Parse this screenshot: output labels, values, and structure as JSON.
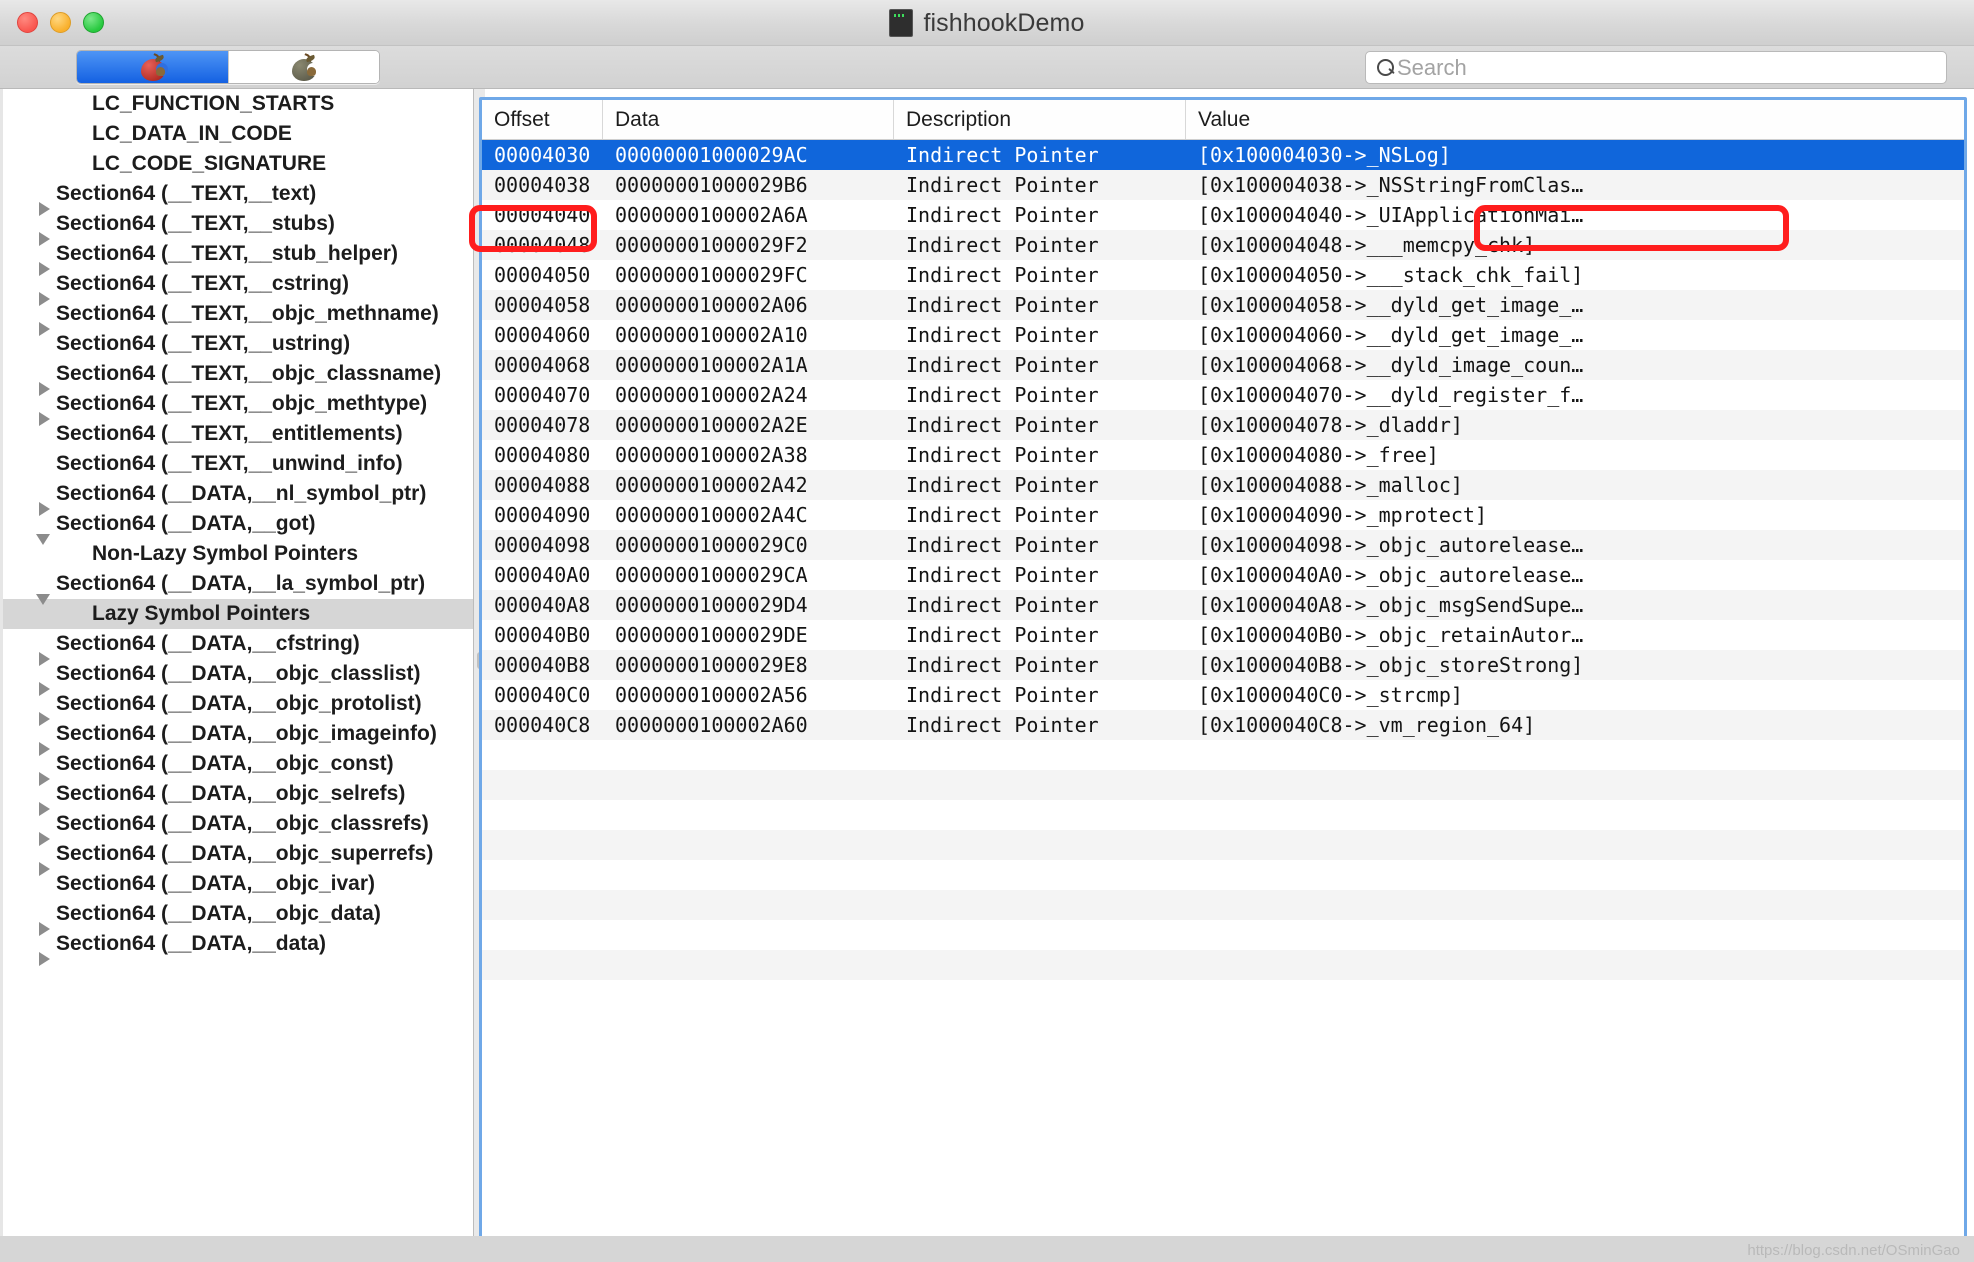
{
  "window": {
    "title": "fishhookDemo",
    "controls": {
      "close": "close-button",
      "minimize": "minimize-button",
      "zoom": "zoom-button"
    },
    "doc_icon": "terminal-document-icon"
  },
  "toolbar": {
    "segments": [
      {
        "name": "red-apple-segment",
        "icon": "red-apple-icon",
        "active": true
      },
      {
        "name": "grey-apple-segment",
        "icon": "grey-apple-icon",
        "active": false
      }
    ],
    "search": {
      "placeholder": "Search",
      "value": "",
      "icon": "search-icon"
    }
  },
  "sidebar": {
    "items": [
      {
        "label": "LC_FUNCTION_STARTS",
        "indent": 1,
        "twisty": "none",
        "selected": false
      },
      {
        "label": "LC_DATA_IN_CODE",
        "indent": 1,
        "twisty": "none",
        "selected": false
      },
      {
        "label": "LC_CODE_SIGNATURE",
        "indent": 1,
        "twisty": "none",
        "selected": false
      },
      {
        "label": "Section64 (__TEXT,__text)",
        "indent": 0,
        "twisty": "closed",
        "selected": false
      },
      {
        "label": "Section64 (__TEXT,__stubs)",
        "indent": 0,
        "twisty": "closed",
        "selected": false
      },
      {
        "label": "Section64 (__TEXT,__stub_helper)",
        "indent": 0,
        "twisty": "closed",
        "selected": false
      },
      {
        "label": "Section64 (__TEXT,__cstring)",
        "indent": 0,
        "twisty": "closed",
        "selected": false
      },
      {
        "label": "Section64 (__TEXT,__objc_methname)",
        "indent": 0,
        "twisty": "closed",
        "selected": false
      },
      {
        "label": "Section64 (__TEXT,__ustring)",
        "indent": 0,
        "twisty": "none",
        "selected": false
      },
      {
        "label": "Section64 (__TEXT,__objc_classname)",
        "indent": 0,
        "twisty": "closed",
        "selected": false
      },
      {
        "label": "Section64 (__TEXT,__objc_methtype)",
        "indent": 0,
        "twisty": "closed",
        "selected": false
      },
      {
        "label": "Section64 (__TEXT,__entitlements)",
        "indent": 0,
        "twisty": "none",
        "selected": false
      },
      {
        "label": "Section64 (__TEXT,__unwind_info)",
        "indent": 0,
        "twisty": "none",
        "selected": false
      },
      {
        "label": "Section64 (__DATA,__nl_symbol_ptr)",
        "indent": 0,
        "twisty": "closed",
        "selected": false
      },
      {
        "label": "Section64 (__DATA,__got)",
        "indent": 0,
        "twisty": "open",
        "selected": false
      },
      {
        "label": "Non-Lazy Symbol Pointers",
        "indent": 1,
        "twisty": "none",
        "selected": false
      },
      {
        "label": "Section64 (__DATA,__la_symbol_ptr)",
        "indent": 0,
        "twisty": "open",
        "selected": false
      },
      {
        "label": "Lazy Symbol Pointers",
        "indent": 1,
        "twisty": "none",
        "selected": true
      },
      {
        "label": "Section64 (__DATA,__cfstring)",
        "indent": 0,
        "twisty": "closed",
        "selected": false
      },
      {
        "label": "Section64 (__DATA,__objc_classlist)",
        "indent": 0,
        "twisty": "closed",
        "selected": false
      },
      {
        "label": "Section64 (__DATA,__objc_protolist)",
        "indent": 0,
        "twisty": "closed",
        "selected": false
      },
      {
        "label": "Section64 (__DATA,__objc_imageinfo)",
        "indent": 0,
        "twisty": "closed",
        "selected": false
      },
      {
        "label": "Section64 (__DATA,__objc_const)",
        "indent": 0,
        "twisty": "closed",
        "selected": false
      },
      {
        "label": "Section64 (__DATA,__objc_selrefs)",
        "indent": 0,
        "twisty": "closed",
        "selected": false
      },
      {
        "label": "Section64 (__DATA,__objc_classrefs)",
        "indent": 0,
        "twisty": "closed",
        "selected": false
      },
      {
        "label": "Section64 (__DATA,__objc_superrefs)",
        "indent": 0,
        "twisty": "closed",
        "selected": false
      },
      {
        "label": "Section64 (__DATA,__objc_ivar)",
        "indent": 0,
        "twisty": "none",
        "selected": false
      },
      {
        "label": "Section64 (__DATA,__objc_data)",
        "indent": 0,
        "twisty": "closed",
        "selected": false
      },
      {
        "label": "Section64 (__DATA,__data)",
        "indent": 0,
        "twisty": "closed",
        "selected": false
      }
    ]
  },
  "table": {
    "columns": [
      "Offset",
      "Data",
      "Description",
      "Value"
    ],
    "rows": [
      {
        "offset": "00004030",
        "data": "00000001000029AC",
        "description": "Indirect Pointer",
        "value": "[0x100004030->_NSLog]",
        "selected": true
      },
      {
        "offset": "00004038",
        "data": "00000001000029B6",
        "description": "Indirect Pointer",
        "value": "[0x100004038->_NSStringFromClas…",
        "selected": false
      },
      {
        "offset": "00004040",
        "data": "0000000100002A6A",
        "description": "Indirect Pointer",
        "value": "[0x100004040->_UIApplicationMai…",
        "selected": false
      },
      {
        "offset": "00004048",
        "data": "00000001000029F2",
        "description": "Indirect Pointer",
        "value": "[0x100004048->___memcpy_chk]",
        "selected": false
      },
      {
        "offset": "00004050",
        "data": "00000001000029FC",
        "description": "Indirect Pointer",
        "value": "[0x100004050->___stack_chk_fail]",
        "selected": false
      },
      {
        "offset": "00004058",
        "data": "0000000100002A06",
        "description": "Indirect Pointer",
        "value": "[0x100004058->__dyld_get_image_…",
        "selected": false
      },
      {
        "offset": "00004060",
        "data": "0000000100002A10",
        "description": "Indirect Pointer",
        "value": "[0x100004060->__dyld_get_image_…",
        "selected": false
      },
      {
        "offset": "00004068",
        "data": "0000000100002A1A",
        "description": "Indirect Pointer",
        "value": "[0x100004068->__dyld_image_coun…",
        "selected": false
      },
      {
        "offset": "00004070",
        "data": "0000000100002A24",
        "description": "Indirect Pointer",
        "value": "[0x100004070->__dyld_register_f…",
        "selected": false
      },
      {
        "offset": "00004078",
        "data": "0000000100002A2E",
        "description": "Indirect Pointer",
        "value": "[0x100004078->_dladdr]",
        "selected": false
      },
      {
        "offset": "00004080",
        "data": "0000000100002A38",
        "description": "Indirect Pointer",
        "value": "[0x100004080->_free]",
        "selected": false
      },
      {
        "offset": "00004088",
        "data": "0000000100002A42",
        "description": "Indirect Pointer",
        "value": "[0x100004088->_malloc]",
        "selected": false
      },
      {
        "offset": "00004090",
        "data": "0000000100002A4C",
        "description": "Indirect Pointer",
        "value": "[0x100004090->_mprotect]",
        "selected": false
      },
      {
        "offset": "00004098",
        "data": "00000001000029C0",
        "description": "Indirect Pointer",
        "value": "[0x100004098->_objc_autorelease…",
        "selected": false
      },
      {
        "offset": "000040A0",
        "data": "00000001000029CA",
        "description": "Indirect Pointer",
        "value": "[0x1000040A0->_objc_autorelease…",
        "selected": false
      },
      {
        "offset": "000040A8",
        "data": "00000001000029D4",
        "description": "Indirect Pointer",
        "value": "[0x1000040A8->_objc_msgSendSupe…",
        "selected": false
      },
      {
        "offset": "000040B0",
        "data": "00000001000029DE",
        "description": "Indirect Pointer",
        "value": "[0x1000040B0->_objc_retainAutor…",
        "selected": false
      },
      {
        "offset": "000040B8",
        "data": "00000001000029E8",
        "description": "Indirect Pointer",
        "value": "[0x1000040B8->_objc_storeStrong]",
        "selected": false
      },
      {
        "offset": "000040C0",
        "data": "0000000100002A56",
        "description": "Indirect Pointer",
        "value": "[0x1000040C0->_strcmp]",
        "selected": false
      },
      {
        "offset": "000040C8",
        "data": "0000000100002A60",
        "description": "Indirect Pointer",
        "value": "[0x1000040C8->_vm_region_64]",
        "selected": false
      }
    ]
  },
  "annotations": [
    {
      "name": "offset-highlight",
      "shape": "rounded-rectangle",
      "color": "#ff1d1d"
    },
    {
      "name": "value-highlight",
      "shape": "rounded-rectangle",
      "color": "#ff1d1d"
    }
  ],
  "watermark": {
    "text": "https://blog.csdn.net/OSminGao"
  }
}
